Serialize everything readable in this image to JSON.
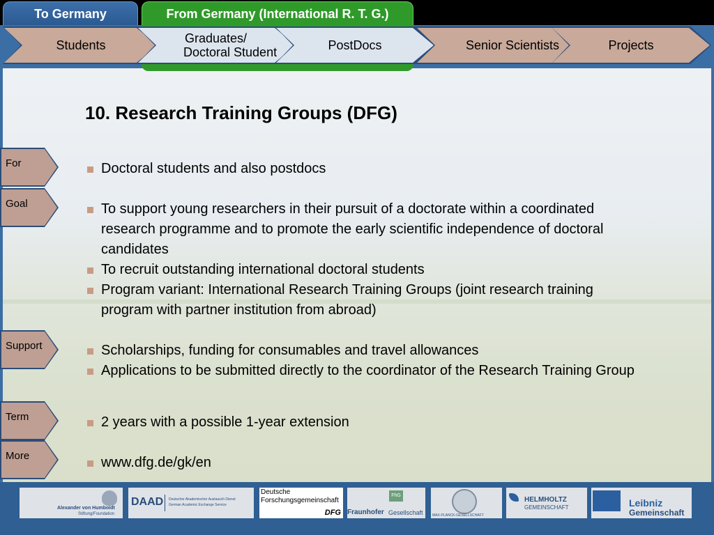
{
  "top_tabs": {
    "to_germany": "To Germany",
    "from_germany": "From Germany (International R. T. G.)"
  },
  "nav": {
    "students": "Students",
    "graduates_line1": "Graduates/",
    "graduates_line2": "Doctoral Student",
    "postdocs": "PostDocs",
    "senior_scientists": "Senior Scientists",
    "projects": "Projects"
  },
  "side_tabs": {
    "for": "For",
    "goal": "Goal",
    "support": "Support",
    "term": "Term",
    "more": "More"
  },
  "content": {
    "title": "10. Research Training Groups (DFG)",
    "for_text": "Doctoral students and also postdocs",
    "goal_1": "To support young researchers in their pursuit of a doctorate within a coordinated research programme and to promote the early scientific independence of doctoral candidates",
    "goal_2": "To recruit outstanding international doctoral students",
    "goal_3": "Program variant: International Research Training Groups (joint research training program with partner institution from abroad)",
    "support_1": "Scholarships, funding for consumables and travel allowances",
    "support_2": "Applications to be submitted directly to the coordinator of the Research Training Group",
    "term_1": "2 years with a possible 1-year extension",
    "more_1": "www.dfg.de/gk/en"
  },
  "logos": {
    "humboldt_1": "Alexander von Humboldt",
    "humboldt_2": "Stiftung/Foundation",
    "daad": "DAAD",
    "daad_sub_1": "Deutscher Akademischer Austausch Dienst",
    "daad_sub_2": "German Academic Exchange Service",
    "dfg_1": "Deutsche",
    "dfg_2": "Forschungsgemeinschaft",
    "dfg_mark": "DFG",
    "fraunhofer": "Fraunhofer",
    "fraunhofer_sub": "Gesellschaft",
    "fhg": "FhG",
    "maxplanck": "MAX-PLANCK-GESELLSCHAFT",
    "helmholtz_1": "HELMHOLTZ",
    "helmholtz_2": "GEMEINSCHAFT",
    "leibniz_1": "Leibniz",
    "leibniz_2": "Gemeinschaft"
  },
  "colors": {
    "frame_blue": "#3b6ea4",
    "tab_green": "#2f9a2a",
    "chevron": "#c8a99a",
    "chevron_active": "#dce4ee",
    "bullet": "#c99b84"
  }
}
